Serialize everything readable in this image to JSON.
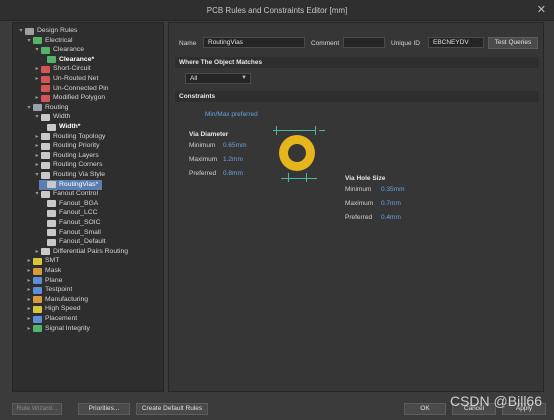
{
  "window": {
    "title": "PCB Rules and Constraints Editor [mm]",
    "close_glyph": "✕"
  },
  "tree": {
    "items": [
      {
        "label": "Design Rules",
        "icon": "folder-icon",
        "twisty": "▾"
      },
      {
        "label": "Electrical",
        "icon": "folder-icon",
        "twisty": "▾"
      },
      {
        "label": "Clearance",
        "icon": "folder-icon",
        "twisty": "▾"
      },
      {
        "label": "Clearance*",
        "icon": "rule-icon",
        "twisty": ""
      },
      {
        "label": "Short-Circuit",
        "icon": "rule-icon",
        "twisty": "▸"
      },
      {
        "label": "Un-Routed Net",
        "icon": "rule-icon",
        "twisty": "▸"
      },
      {
        "label": "Un-Connected Pin",
        "icon": "rule-icon",
        "twisty": ""
      },
      {
        "label": "Modified Polygon",
        "icon": "rule-icon",
        "twisty": "▸"
      },
      {
        "label": "Routing",
        "icon": "folder-icon",
        "twisty": "▾"
      },
      {
        "label": "Width",
        "icon": "folder-icon",
        "twisty": "▾"
      },
      {
        "label": "Width*",
        "icon": "rule-icon",
        "twisty": ""
      },
      {
        "label": "Routing Topology",
        "icon": "rule-icon",
        "twisty": "▸"
      },
      {
        "label": "Routing Priority",
        "icon": "rule-icon",
        "twisty": "▸"
      },
      {
        "label": "Routing Layers",
        "icon": "rule-icon",
        "twisty": "▸"
      },
      {
        "label": "Routing Corners",
        "icon": "rule-icon",
        "twisty": "▸"
      },
      {
        "label": "Routing Via Style",
        "icon": "folder-icon",
        "twisty": "▾"
      },
      {
        "label": "RoutingVias*",
        "icon": "rule-icon",
        "twisty": ""
      },
      {
        "label": "Fanout Control",
        "icon": "folder-icon",
        "twisty": "▾"
      },
      {
        "label": "Fanout_BGA",
        "icon": "rule-icon",
        "twisty": ""
      },
      {
        "label": "Fanout_LCC",
        "icon": "rule-icon",
        "twisty": ""
      },
      {
        "label": "Fanout_SOIC",
        "icon": "rule-icon",
        "twisty": ""
      },
      {
        "label": "Fanout_Small",
        "icon": "rule-icon",
        "twisty": ""
      },
      {
        "label": "Fanout_Default",
        "icon": "rule-icon",
        "twisty": ""
      },
      {
        "label": "Differential Pairs Routing",
        "icon": "rule-icon",
        "twisty": "▸"
      },
      {
        "label": "SMT",
        "icon": "folder-icon",
        "twisty": "▸"
      },
      {
        "label": "Mask",
        "icon": "folder-icon",
        "twisty": "▸"
      },
      {
        "label": "Plane",
        "icon": "folder-icon",
        "twisty": "▸"
      },
      {
        "label": "Testpoint",
        "icon": "folder-icon",
        "twisty": "▸"
      },
      {
        "label": "Manufacturing",
        "icon": "folder-icon",
        "twisty": "▸"
      },
      {
        "label": "High Speed",
        "icon": "folder-icon",
        "twisty": "▸"
      },
      {
        "label": "Placement",
        "icon": "folder-icon",
        "twisty": "▸"
      },
      {
        "label": "Signal Integrity",
        "icon": "folder-icon",
        "twisty": "▸"
      }
    ]
  },
  "rule": {
    "name_label": "Name",
    "name_value": "RoutingVias",
    "comment_label": "Comment",
    "comment_value": "",
    "uid_label": "Unique ID",
    "uid_value": "EBCNEYDV",
    "test_queries_label": "Test Queries"
  },
  "match": {
    "header": "Where The Object Matches",
    "selected": "All"
  },
  "constraints": {
    "header": "Constraints",
    "min_max_label": "Min/Max preferred",
    "via_diameter": {
      "title": "Via Diameter",
      "min_label": "Minimum",
      "min": "0.65mm",
      "max_label": "Maximum",
      "max": "1.2mm",
      "pref_label": "Preferred",
      "pref": "0.8mm"
    },
    "via_hole": {
      "title": "Via Hole Size",
      "min_label": "Minimum",
      "min": "0.35mm",
      "max_label": "Maximum",
      "max": "0.7mm",
      "pref_label": "Preferred",
      "pref": "0.4mm"
    }
  },
  "footer": {
    "rule_wizard": "Rule Wizard...",
    "priorities": "Priorities...",
    "create_default": "Create Default Rules",
    "ok": "OK",
    "cancel": "Cancel",
    "apply": "Apply"
  },
  "watermark": "CSDN @Bill66",
  "colors": {
    "selection": "#5b7fb0",
    "via_copper": "#e4b51c",
    "value_blue": "#6aa3e0",
    "dimension": "#4fb6a2"
  }
}
